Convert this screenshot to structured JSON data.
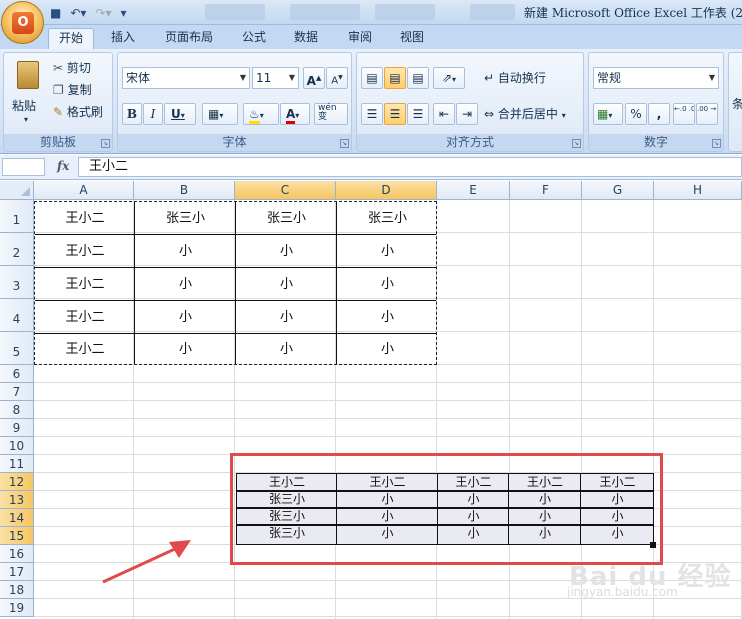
{
  "window": {
    "title": "新建 Microsoft Office Excel 工作表 (2)"
  },
  "tabs": [
    "开始",
    "插入",
    "页面布局",
    "公式",
    "数据",
    "审阅",
    "视图"
  ],
  "clipboard": {
    "paste": "粘贴",
    "cut": "剪切",
    "copy": "复制",
    "format_painter": "格式刷",
    "label": "剪贴板"
  },
  "font": {
    "name": "宋体",
    "size": "11",
    "grow": "A",
    "shrink": "A",
    "bold": "B",
    "italic": "I",
    "underline": "U",
    "font_color_glyph": "A",
    "wen": "wén\n变",
    "label": "字体"
  },
  "alignment": {
    "wrap": "自动换行",
    "merge": "合并后居中",
    "label": "对齐方式"
  },
  "number": {
    "format": "常规",
    "percent": "%",
    "comma": ",",
    "inc_decimal": "←.0 .00",
    "dec_decimal": ".00 →.0",
    "label": "数字",
    "styles_partial": "条"
  },
  "formula_bar": {
    "fx": "fx",
    "value": "王小二"
  },
  "columns": [
    "A",
    "B",
    "C",
    "D",
    "E",
    "F",
    "G",
    "H"
  ],
  "rows": [
    "1",
    "2",
    "3",
    "4",
    "5",
    "6",
    "7",
    "8",
    "9",
    "10",
    "11",
    "12",
    "13",
    "14",
    "15",
    "16",
    "17",
    "18",
    "19"
  ],
  "table1": [
    [
      "王小二",
      "张三小",
      "张三小",
      "张三小"
    ],
    [
      "王小二",
      "小",
      "小",
      "小"
    ],
    [
      "王小二",
      "小",
      "小",
      "小"
    ],
    [
      "王小二",
      "小",
      "小",
      "小"
    ],
    [
      "王小二",
      "小",
      "小",
      "小"
    ]
  ],
  "table2": [
    [
      "王小二",
      "王小二",
      "王小二",
      "王小二",
      "王小二"
    ],
    [
      "张三小",
      "小",
      "小",
      "小",
      "小"
    ],
    [
      "张三小",
      "小",
      "小",
      "小",
      "小"
    ],
    [
      "张三小",
      "小",
      "小",
      "小",
      "小"
    ]
  ],
  "watermark": {
    "logo": "Bai du 经验",
    "url": "jingyan.baidu.com"
  },
  "colors": {
    "arrow": "#e04a4a",
    "highlight_box": "#e04a4a",
    "selected_header": "#f6c560",
    "ribbon": "#d5e3f4"
  }
}
